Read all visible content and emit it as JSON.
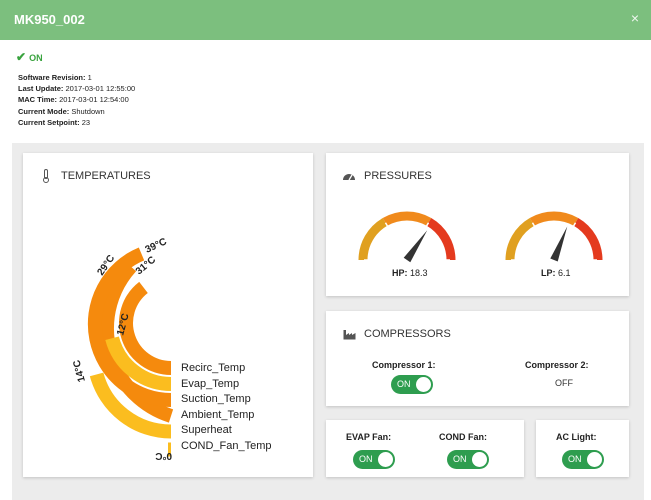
{
  "window": {
    "title": "MK950_002",
    "close_glyph": "×"
  },
  "status": {
    "icon": "check-icon",
    "text": "ON",
    "color": "#3aa33f"
  },
  "info": {
    "software_revision": {
      "label": "Software Revision:",
      "value": "1"
    },
    "last_update": {
      "label": "Last Update:",
      "value": "2017-03-01 12:55:00"
    },
    "mac_time": {
      "label": "MAC Time:",
      "value": "2017-03-01 12:54:00"
    },
    "current_mode": {
      "label": "Current Mode:",
      "value": "Shutdown"
    },
    "current_setpoint": {
      "label": "Current Setpoint:",
      "value": "23"
    }
  },
  "temperatures": {
    "title": "TEMPERATURES",
    "icon": "thermometer-icon",
    "legend": [
      "Recirc_Temp",
      "Evap_Temp",
      "Suction_Temp",
      "Ambient_Temp",
      "Superheat",
      "COND_Fan_Temp"
    ],
    "values": [
      "31°C",
      "12°C",
      "39°C",
      "29°C",
      "14°C",
      "0°C"
    ]
  },
  "pressures": {
    "title": "PRESSURES",
    "icon": "speedometer-icon",
    "hp": {
      "label": "HP:",
      "value": "18.3",
      "needle_fraction": 0.69
    },
    "lp": {
      "label": "LP:",
      "value": "6.1",
      "needle_fraction": 0.62
    }
  },
  "compressors": {
    "title": "COMPRESSORS",
    "icon": "factory-icon",
    "c1": {
      "label": "Compressor 1:",
      "state": "ON"
    },
    "c2": {
      "label": "Compressor 2:",
      "state": "OFF"
    }
  },
  "fans": {
    "evap": {
      "label": "EVAP Fan:",
      "state": "ON"
    },
    "cond": {
      "label": "COND Fan:",
      "state": "ON"
    }
  },
  "ac_light": {
    "label": "AC Light:",
    "state": "ON"
  },
  "colors": {
    "header_green": "#7cbf7e",
    "toggle_green": "#2e9d4f",
    "gauge_low": "#e0a020",
    "gauge_mid": "#f08a1c",
    "gauge_high": "#e43a1e",
    "temp_orange": "#f58a0d",
    "temp_yellow": "#fbbd1f"
  }
}
